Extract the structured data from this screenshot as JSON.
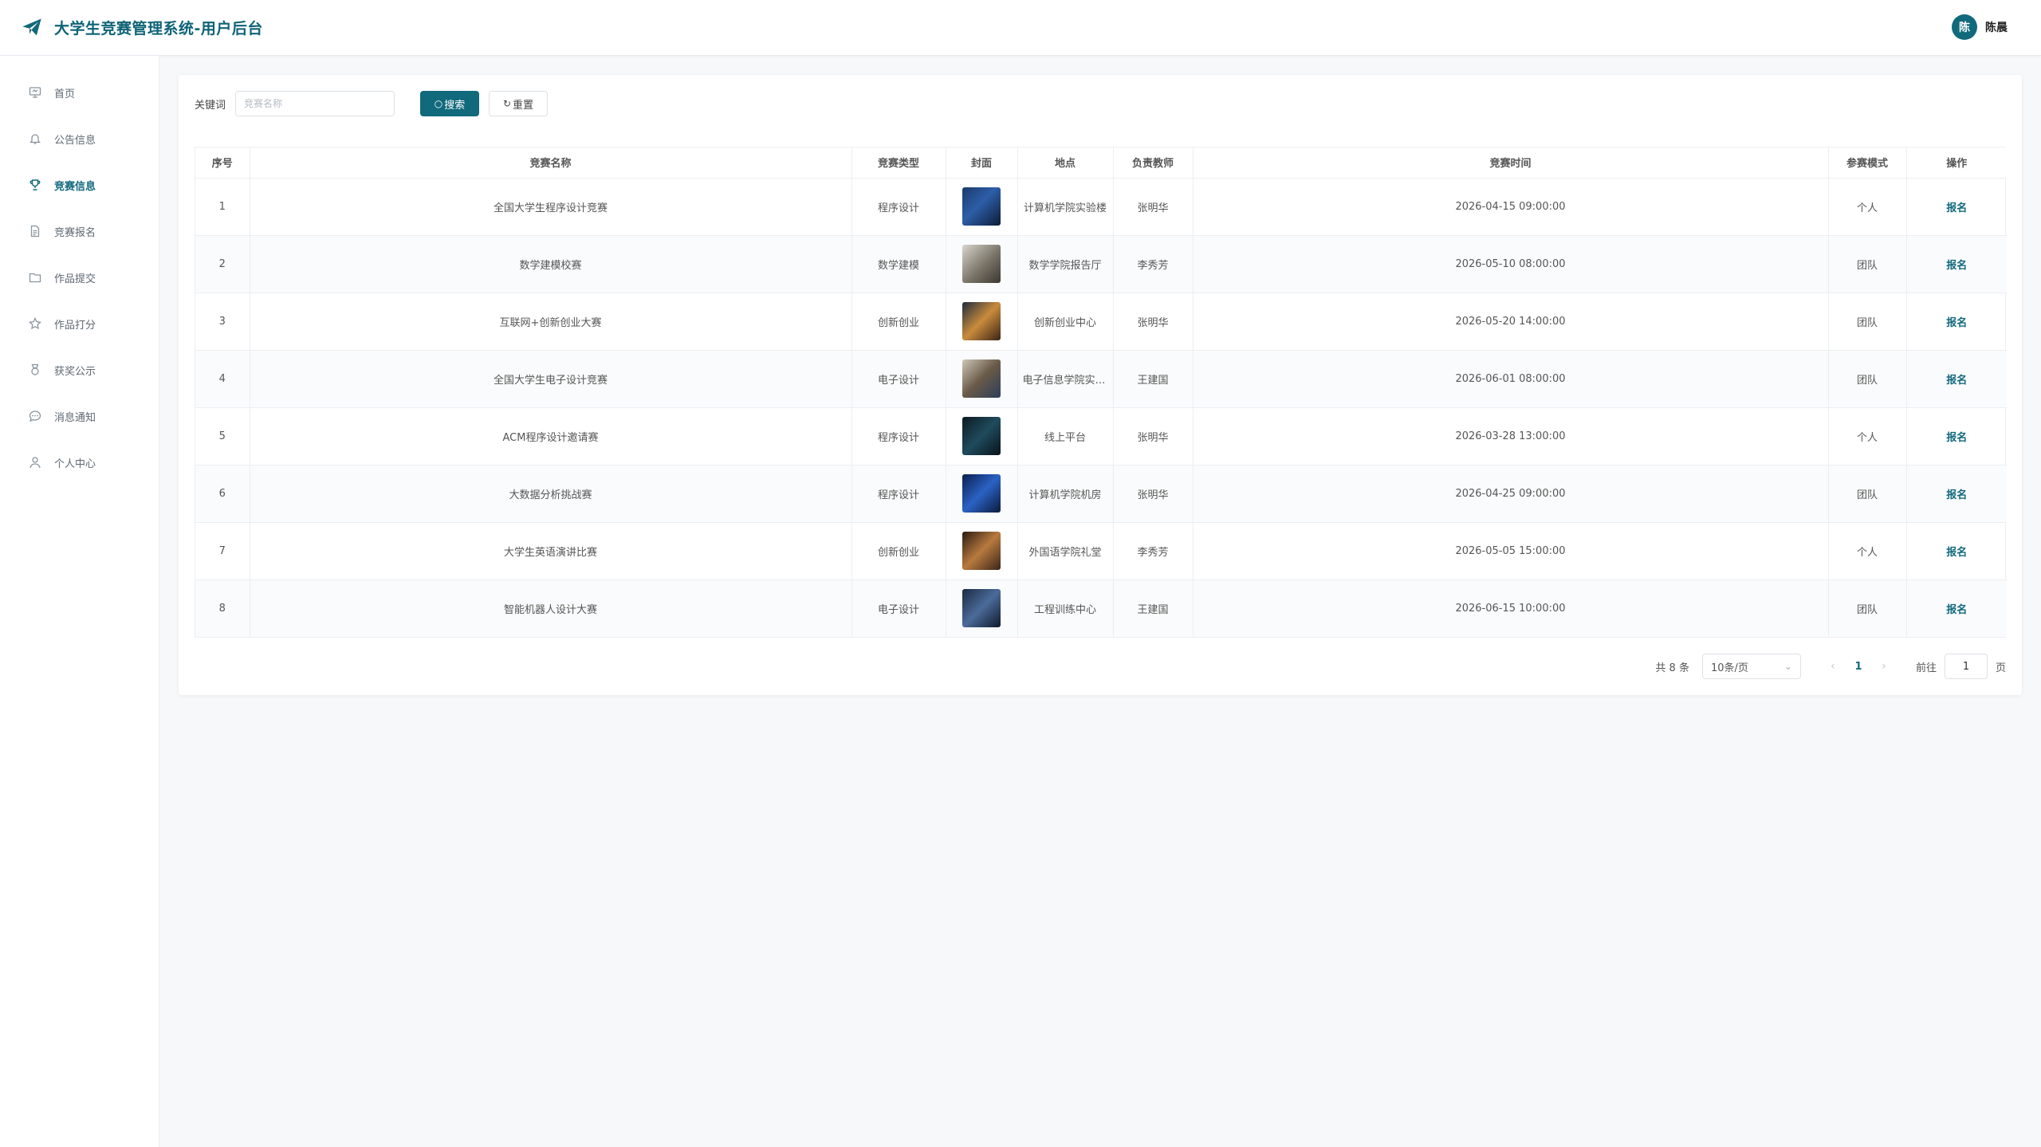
{
  "header": {
    "title": "大学生竞赛管理系统-用户后台",
    "avatar_text": "陈",
    "username": "陈晨"
  },
  "sidebar": {
    "items": [
      {
        "label": "首页",
        "icon": "screen-icon",
        "active": false
      },
      {
        "label": "公告信息",
        "icon": "bell-icon",
        "active": false
      },
      {
        "label": "竞赛信息",
        "icon": "trophy-icon",
        "active": true
      },
      {
        "label": "竞赛报名",
        "icon": "document-icon",
        "active": false
      },
      {
        "label": "作品提交",
        "icon": "folder-icon",
        "active": false
      },
      {
        "label": "作品打分",
        "icon": "star-icon",
        "active": false
      },
      {
        "label": "获奖公示",
        "icon": "medal-icon",
        "active": false
      },
      {
        "label": "消息通知",
        "icon": "chat-icon",
        "active": false
      },
      {
        "label": "个人中心",
        "icon": "user-icon",
        "active": false
      }
    ]
  },
  "search": {
    "label": "关键词",
    "placeholder": "竞赛名称",
    "value": "",
    "search_button": "搜索",
    "reset_button": "重置"
  },
  "table": {
    "columns": [
      "序号",
      "竞赛名称",
      "竞赛类型",
      "封面",
      "地点",
      "负责教师",
      "竞赛时间",
      "参赛模式",
      "操作"
    ],
    "rows": [
      {
        "no": "1",
        "name": "全国大学生程序设计竞赛",
        "type": "程序设计",
        "cover": "cover-image",
        "place": "计算机学院实验楼",
        "teacher": "张明华",
        "time": "2026-04-15 09:00:00",
        "mode": "个人",
        "action": "报名"
      },
      {
        "no": "2",
        "name": "数学建模校赛",
        "type": "数学建模",
        "cover": "cover-image",
        "place": "数学学院报告厅",
        "teacher": "李秀芳",
        "time": "2026-05-10 08:00:00",
        "mode": "团队",
        "action": "报名"
      },
      {
        "no": "3",
        "name": "互联网+创新创业大赛",
        "type": "创新创业",
        "cover": "cover-image",
        "place": "创新创业中心",
        "teacher": "张明华",
        "time": "2026-05-20 14:00:00",
        "mode": "团队",
        "action": "报名"
      },
      {
        "no": "4",
        "name": "全国大学生电子设计竞赛",
        "type": "电子设计",
        "cover": "cover-image",
        "place": "电子信息学院实验室",
        "teacher": "王建国",
        "time": "2026-06-01 08:00:00",
        "mode": "团队",
        "action": "报名"
      },
      {
        "no": "5",
        "name": "ACM程序设计邀请赛",
        "type": "程序设计",
        "cover": "cover-image",
        "place": "线上平台",
        "teacher": "张明华",
        "time": "2026-03-28 13:00:00",
        "mode": "个人",
        "action": "报名"
      },
      {
        "no": "6",
        "name": "大数据分析挑战赛",
        "type": "程序设计",
        "cover": "cover-image",
        "place": "计算机学院机房",
        "teacher": "张明华",
        "time": "2026-04-25 09:00:00",
        "mode": "团队",
        "action": "报名"
      },
      {
        "no": "7",
        "name": "大学生英语演讲比赛",
        "type": "创新创业",
        "cover": "cover-image",
        "place": "外国语学院礼堂",
        "teacher": "李秀芳",
        "time": "2026-05-05 15:00:00",
        "mode": "个人",
        "action": "报名"
      },
      {
        "no": "8",
        "name": "智能机器人设计大赛",
        "type": "电子设计",
        "cover": "cover-image",
        "place": "工程训练中心",
        "teacher": "王建国",
        "time": "2026-06-15 10:00:00",
        "mode": "团队",
        "action": "报名"
      }
    ]
  },
  "pagination": {
    "total_text": "共 8 条",
    "page_size": "10条/页",
    "current_page": "1",
    "goto_label": "前往",
    "goto_value": "1",
    "page_unit": "页"
  },
  "colors": {
    "accent": "#11697c",
    "background": "#f6f8fa"
  }
}
